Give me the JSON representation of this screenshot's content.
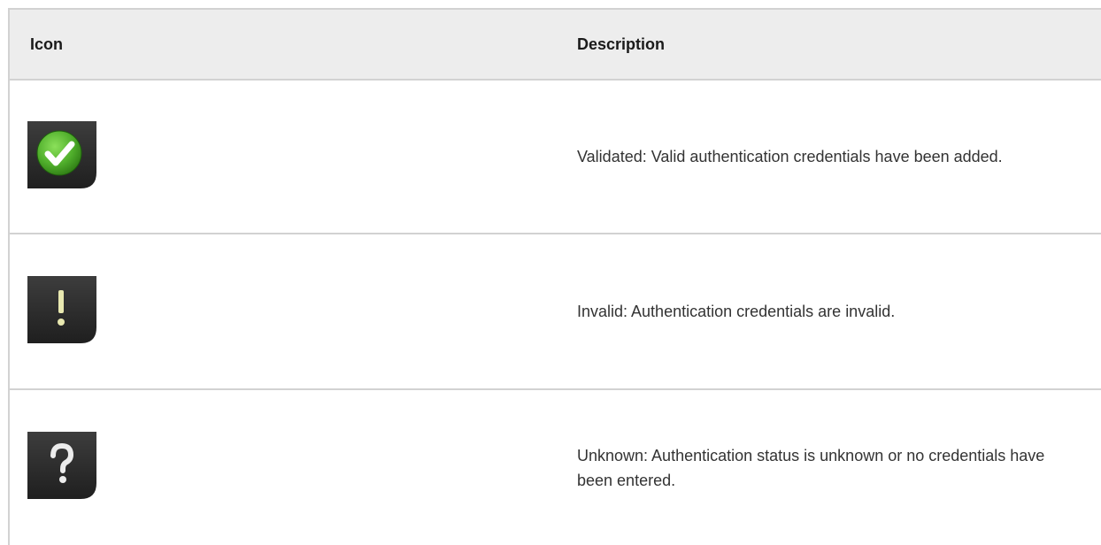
{
  "table": {
    "headers": {
      "icon": "Icon",
      "description": "Description"
    },
    "rows": [
      {
        "icon": "validated-check-icon",
        "description": "Validated: Valid authentication credentials have been added."
      },
      {
        "icon": "invalid-exclamation-icon",
        "description": "Invalid: Authentication credentials are invalid."
      },
      {
        "icon": "unknown-question-icon",
        "description": "Unknown: Authentication status is unknown or no credentials have been entered."
      }
    ]
  },
  "colors": {
    "header_bg": "#ededed",
    "border": "#d2d2d2",
    "icon_bg": "#2f2f2f",
    "check_green": "#52b52f"
  }
}
